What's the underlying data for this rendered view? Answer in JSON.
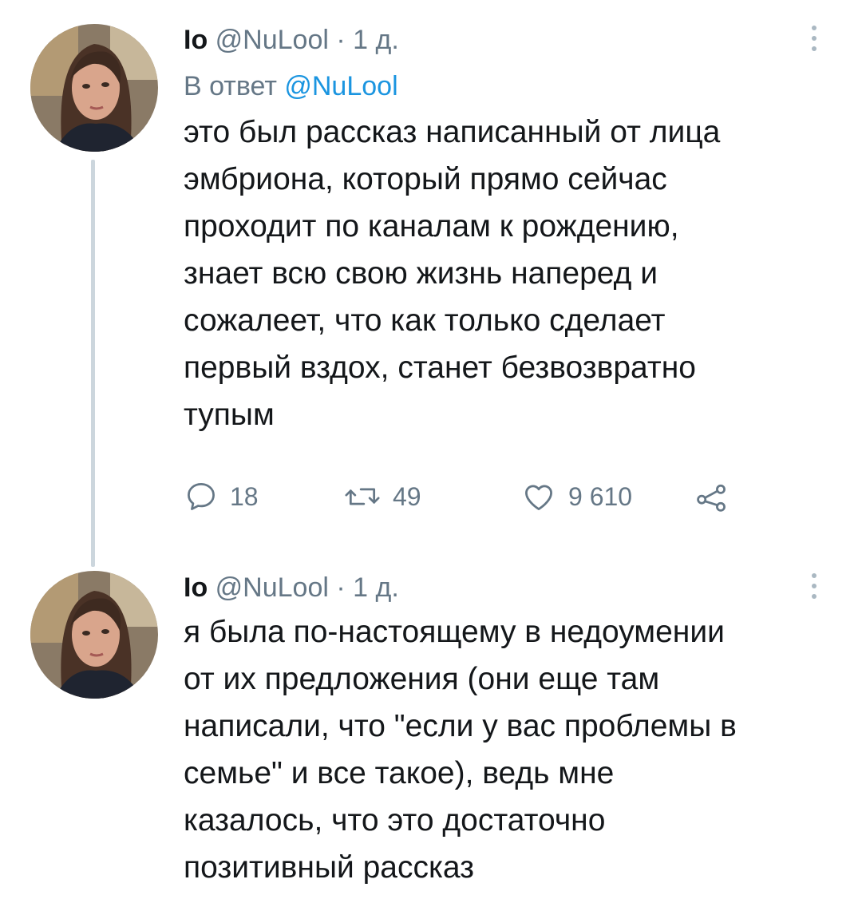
{
  "tweets": [
    {
      "author_name": "Io",
      "author_handle": "@NuLool",
      "separator": "·",
      "time": "1 д.",
      "reply_prefix": "В ответ",
      "reply_mention": "@NuLool",
      "text_lines": [
        "это был рассказ написанный от лица",
        "эмбриона, который прямо сейчас",
        "проходит по каналам к рождению,",
        "знает всю свою жизнь наперед и",
        "сожалеет, что как только сделает",
        "первый вздох, станет безвозвратно",
        "тупым"
      ],
      "actions": {
        "reply_count": "18",
        "retweet_count": "49",
        "like_count": "9 610"
      }
    },
    {
      "author_name": "Io",
      "author_handle": "@NuLool",
      "separator": "·",
      "time": "1 д.",
      "text_lines": [
        "я была по-настоящему в недоумении",
        "от их предложения (они еще там",
        "написали, что \"если у вас проблемы в",
        "семье\" и все такое), ведь мне",
        "казалось, что это достаточно",
        "позитивный рассказ"
      ]
    }
  ],
  "icons": {
    "reply": "reply-icon",
    "retweet": "retweet-icon",
    "like": "heart-icon",
    "share": "share-icon",
    "more": "more-vertical-icon"
  },
  "colors": {
    "text": "#14171a",
    "secondary": "#657786",
    "link": "#1b95e0",
    "thread_line": "#ccd6dd"
  }
}
